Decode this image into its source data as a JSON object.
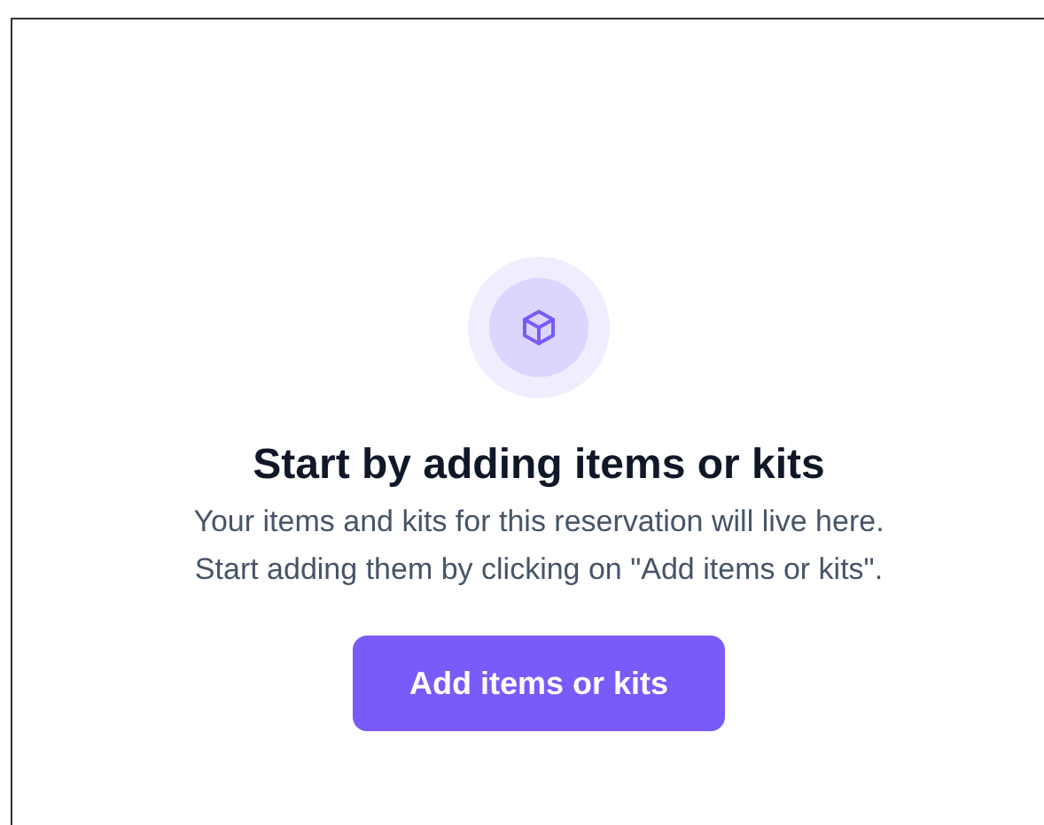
{
  "empty_state": {
    "title": "Start by adding items or kits",
    "description_lines": [
      "Your items and kits for this reservation will live here.",
      "Start adding them by clicking on \"Add items or kits\"."
    ],
    "button": "Add items or kits"
  }
}
